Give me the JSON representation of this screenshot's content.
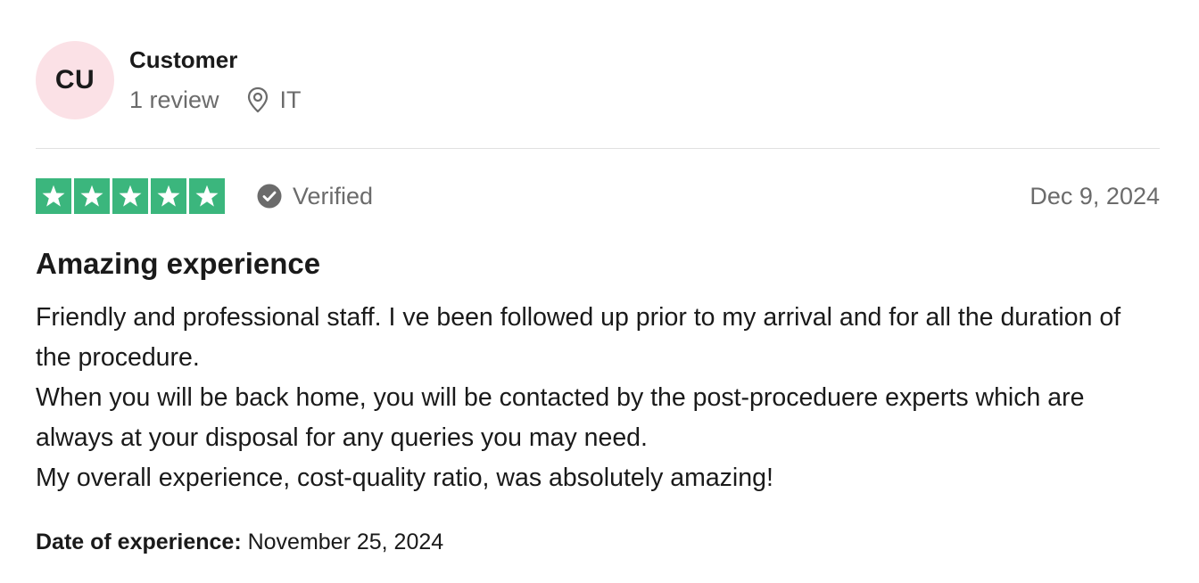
{
  "consumer": {
    "initials": "CU",
    "name": "Customer",
    "review_count": "1 review",
    "country": "IT",
    "avatar_color": "#fbe1e6"
  },
  "rating": {
    "stars": 5,
    "max_stars": 5,
    "star_color": "#3bb67d",
    "icon": "star-icon"
  },
  "verified": {
    "label": "Verified",
    "icon": "check-circle-icon"
  },
  "review": {
    "date": "Dec 9, 2024",
    "title": "Amazing experience",
    "paragraphs": [
      "Friendly and professional staff. I ve been followed up prior to my arrival and for all the duration of the procedure.",
      "When you will be back home, you will be contacted by the post-proceduere experts which are always at your disposal for any queries you may need.",
      "My overall experience, cost-quality ratio, was absolutely amazing!"
    ]
  },
  "experience": {
    "label": "Date of experience:",
    "date": "November 25, 2024"
  }
}
